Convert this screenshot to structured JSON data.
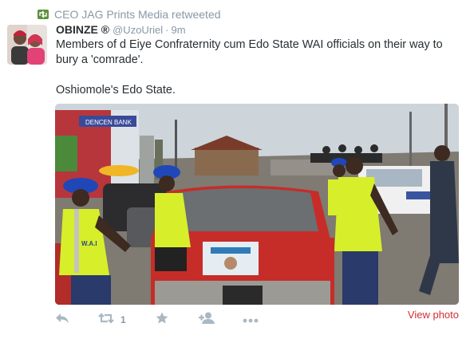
{
  "retweet_context": {
    "text": "CEO JAG Prints Media retweeted"
  },
  "author": {
    "name": "OBINZE ®",
    "handle": "@UzoUriel",
    "separator": "·",
    "time": "9m"
  },
  "tweet": {
    "line1": "Members of d Eiye Confraternity cum Edo State WAI officials on their way to bury a 'comrade'.",
    "line2": "Oshiomole's Edo State."
  },
  "media": {
    "shop_sign": "DENCEN BANK",
    "vest_badge": "W.A.I",
    "description_colors": {
      "car": "#c62d28",
      "vest": "#d7ef2a",
      "beret": "#2047b8",
      "sky": "#c9d2d8"
    }
  },
  "actions": {
    "reply_icon": "reply-icon",
    "retweet_icon": "retweet-icon",
    "retweet_count": "1",
    "favorite_icon": "star-icon",
    "follow_icon": "add-user-icon",
    "more_icon": "more-icon"
  },
  "view_photo": "View photo",
  "colors": {
    "accent": "#d02e36",
    "muted": "#8899a6",
    "retweet_green": "#5c913b",
    "text": "#292f33"
  }
}
